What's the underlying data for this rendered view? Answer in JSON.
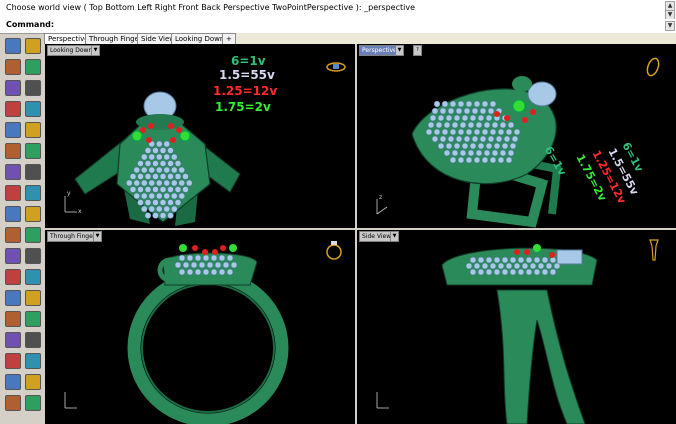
{
  "command": {
    "history_text": "Choose world view ( Top  Bottom  Left  Right  Front  Back  Perspective  TwoPointPerspective ): _perspective",
    "prompt_label": "Command:",
    "input_value": ""
  },
  "tabs": [
    {
      "label": "Perspective",
      "active": true
    },
    {
      "label": "Through Finger",
      "active": false
    },
    {
      "label": "Side View",
      "active": false
    },
    {
      "label": "Looking Down",
      "active": false
    },
    {
      "label": "+",
      "active": false
    }
  ],
  "viewports": {
    "top_left": {
      "label": "Looking Down",
      "active": false
    },
    "top_right": {
      "label": "Perspective",
      "active": true,
      "help": "?"
    },
    "bottom_left": {
      "label": "Through Finger",
      "active": false
    },
    "bottom_right": {
      "label": "Side View",
      "active": false
    }
  },
  "legend": {
    "line1": "6=1v",
    "line2": "1.5=55v",
    "line3": "1.25=12v",
    "line4": "1.75=2v",
    "colors": {
      "line1": "#2fbf7a",
      "line2": "#d8d8f0",
      "line3": "#ff2a2a",
      "line4": "#33ee33"
    }
  },
  "axes": {
    "x": "x",
    "y": "y",
    "z": "z"
  },
  "toolbar_icons": [
    "select-arrow-icon",
    "point-icon",
    "line-icon",
    "polyline-icon",
    "curve-icon",
    "arc-icon",
    "circle-icon",
    "rectangle-icon",
    "polygon-icon",
    "ellipse-icon",
    "freeform-icon",
    "fillet-icon",
    "extrude-icon",
    "surface-icon",
    "box-icon",
    "sphere-icon",
    "cylinder-icon",
    "cone-icon",
    "boolean-icon",
    "mesh-icon",
    "transform-icon",
    "move-icon",
    "rotate-icon",
    "scale-icon",
    "mirror-icon",
    "array-icon",
    "text-icon",
    "dimension-icon",
    "layer-icon",
    "render-icon",
    "lock-icon",
    "hide-icon",
    "group-icon",
    "snap-icon",
    "analyze-icon",
    "more-icon"
  ],
  "colors": {
    "ring": "#2a8a5a",
    "ring_dark": "#14553a",
    "stone": "#a8c8e8",
    "red_stone": "#e02020",
    "green_stone": "#33dd33",
    "gold": "#d9a020"
  }
}
